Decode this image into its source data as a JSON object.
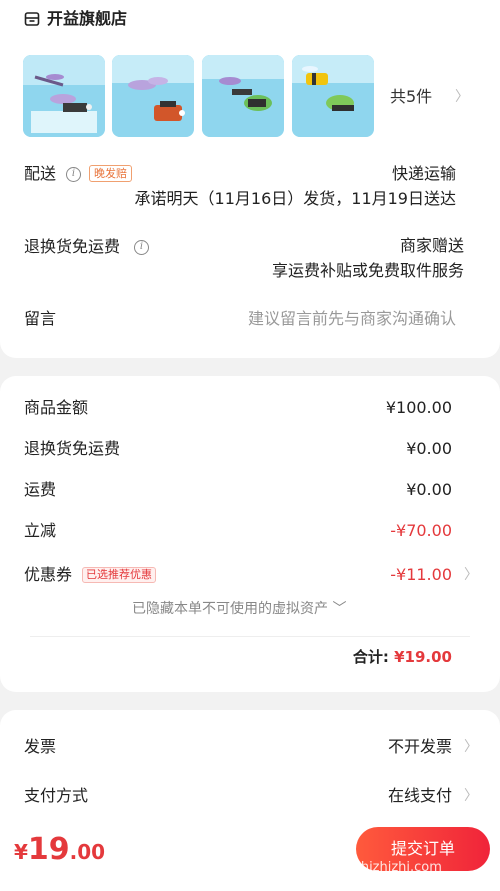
{
  "store": {
    "name": "开益旗舰店",
    "icon": "store-icon"
  },
  "products": {
    "count_label": "共5件",
    "thumbnails": [
      "dragonfly-kit",
      "ant-kit",
      "mantis-kit",
      "bee-kit"
    ]
  },
  "delivery": {
    "label": "配送",
    "badge": "晚发赔",
    "method": "快递运输",
    "promise": "承诺明天（11月16日）发货，11月19日送达"
  },
  "return_shipping": {
    "label": "退换货免运费",
    "value": "商家赠送",
    "desc": "享运费补贴或免费取件服务"
  },
  "message": {
    "label": "留言",
    "placeholder": "建议留言前先与商家沟通确认"
  },
  "summary": {
    "goods_amount_label": "商品金额",
    "goods_amount": "¥100.00",
    "return_fee_label": "退换货免运费",
    "return_fee": "¥0.00",
    "shipping_label": "运费",
    "shipping": "¥0.00",
    "discount_label": "立减",
    "discount": "-¥70.00",
    "coupon_label": "优惠券",
    "coupon_badge": "已选推荐优惠",
    "coupon": "-¥11.00",
    "hidden_assets": "已隐藏本单不可使用的虚拟资产",
    "total_label": "合计:",
    "total": "¥19.00"
  },
  "invoice": {
    "label": "发票",
    "value": "不开发票"
  },
  "payment": {
    "label": "支付方式",
    "value": "在线支付"
  },
  "footer": {
    "price_symbol": "¥",
    "price_int": "19",
    "price_dec": ".00",
    "submit": "提交订单",
    "watermark": "zhizhizhi.com"
  },
  "colors": {
    "accent": "#e4393c",
    "orange": "#e8743b",
    "background": "#f2f2f2"
  }
}
